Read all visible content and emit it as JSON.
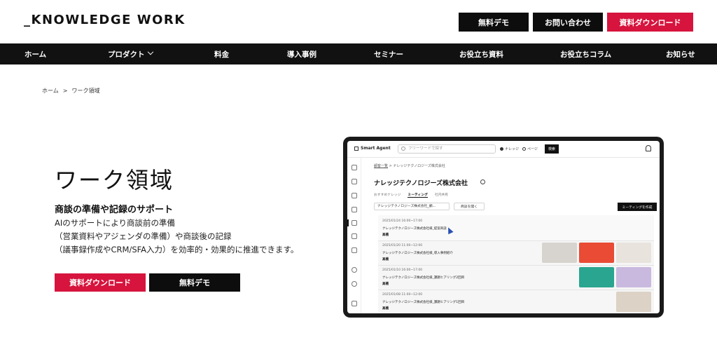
{
  "header": {
    "logo": "_KNOWLEDGE WORK",
    "demo_label": "無料デモ",
    "contact_label": "お問い合わせ",
    "download_label": "資料ダウンロード"
  },
  "nav": {
    "items": [
      {
        "label": "ホーム"
      },
      {
        "label": "プロダクト"
      },
      {
        "label": "料金"
      },
      {
        "label": "導入事例"
      },
      {
        "label": "セミナー"
      },
      {
        "label": "お役立ち資料"
      },
      {
        "label": "お役立ちコラム"
      },
      {
        "label": "お知らせ"
      }
    ]
  },
  "breadcrumb": {
    "home": "ホーム",
    "separator": ">",
    "current": "ワーク領域"
  },
  "hero": {
    "title": "ワーク領域",
    "subtitle": "商談の準備や記録のサポート",
    "desc_lines": [
      "AIのサポートにより商談前の準備",
      "（営業資料やアジェンダの準備）や商談後の記録",
      "（議事録作成やCRM/SFA入力）を効率的・効果的に推進できます。"
    ],
    "cta_download": "資料ダウンロード",
    "cta_demo": "無料デモ"
  },
  "mockup": {
    "brand": "Smart Agent",
    "search_placeholder": "フリーワードで探す",
    "radio_knowledge": "ナレッジ",
    "radio_page": "ページ",
    "search_button": "検索",
    "crumb_link": "顧客一覧",
    "crumb_sep": ">",
    "crumb_current": "ナレッジテクノロジーズ株式会社",
    "company": "ナレッジテクノロジーズ株式会社",
    "tabs": [
      "おすすめナレッジ",
      "ミーティング",
      "社内共有"
    ],
    "select_value": "ナレッジテクノロジーズ株式会社_顧...",
    "open_deal": "商談を開く",
    "create_meeting": "ミーティングを作成",
    "rows": [
      {
        "datetime": "2025/01/24 16:00~17:00",
        "title": "ナレッジテクノロジーズ株式会社様_提案商談",
        "owner": "高橋"
      },
      {
        "datetime": "2025/01/20 11:00~12:00",
        "title": "ナレッジテクノロジーズ株式会社様_導入事例紹介",
        "owner": "高橋"
      },
      {
        "datetime": "2025/01/10 16:00~17:00",
        "title": "ナレッジテクノロジーズ株式会社様_課題ヒアリング2回目",
        "owner": "高橋"
      },
      {
        "datetime": "2025/01/08 11:00~12:00",
        "title": "ナレッジテクノロジーズ株式会社様_課題ヒアリング1回目",
        "owner": "高橋"
      }
    ]
  },
  "colors": {
    "accent_red": "#d6143d",
    "dark": "#0d0d0d",
    "nav_bg": "#111111"
  }
}
